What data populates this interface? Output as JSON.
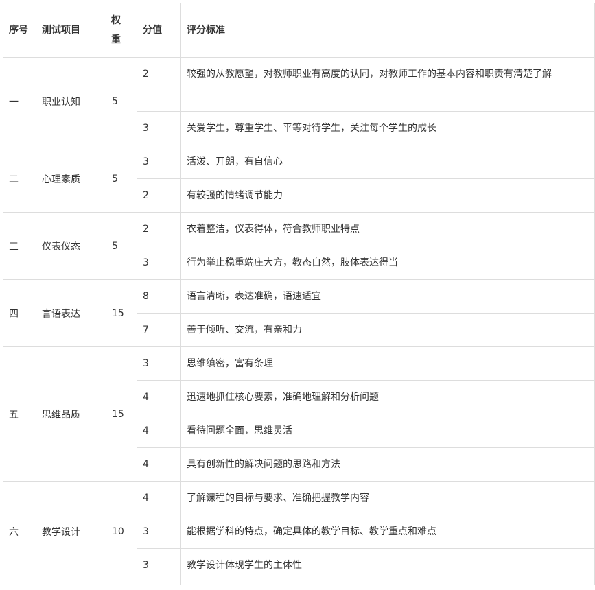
{
  "table": {
    "headers": {
      "seq": "序号",
      "item": "测试项目",
      "weight": "权重",
      "score": "分值",
      "criteria": "评分标准"
    },
    "groups": [
      {
        "seq": "一",
        "item": "职业认知",
        "weight": "5",
        "rows": [
          {
            "score": "2",
            "criteria": "较强的从教愿望，对教师职业有高度的认同，对教师工作的基本内容和职责有清楚了解"
          },
          {
            "score": "3",
            "criteria": "关爱学生，尊重学生、平等对待学生，关注每个学生的成长"
          }
        ]
      },
      {
        "seq": "二",
        "item": "心理素质",
        "weight": "5",
        "rows": [
          {
            "score": "3",
            "criteria": "活泼、开朗，有自信心"
          },
          {
            "score": "2",
            "criteria": "有较强的情绪调节能力"
          }
        ]
      },
      {
        "seq": "三",
        "item": "仪表仪态",
        "weight": "5",
        "rows": [
          {
            "score": "2",
            "criteria": "衣着整洁，仪表得体，符合教师职业特点"
          },
          {
            "score": "3",
            "criteria": "行为举止稳重端庄大方，教态自然，肢体表达得当"
          }
        ]
      },
      {
        "seq": "四",
        "item": "言语表达",
        "weight": "15",
        "rows": [
          {
            "score": "8",
            "criteria": "语言清晰，表达准确，语速适宜"
          },
          {
            "score": "7",
            "criteria": "善于倾听、交流，有亲和力"
          }
        ]
      },
      {
        "seq": "五",
        "item": "思维品质",
        "weight": "15",
        "rows": [
          {
            "score": "3",
            "criteria": "思维缜密，富有条理"
          },
          {
            "score": "4",
            "criteria": "迅速地抓住核心要素，准确地理解和分析问题"
          },
          {
            "score": "4",
            "criteria": "看待问题全面，思维灵活"
          },
          {
            "score": "4",
            "criteria": "具有创新性的解决问题的思路和方法"
          }
        ]
      },
      {
        "seq": "六",
        "item": "教学设计",
        "weight": "10",
        "rows": [
          {
            "score": "4",
            "criteria": "了解课程的目标与要求、准确把握教学内容"
          },
          {
            "score": "3",
            "criteria": "能根据学科的特点，确定具体的教学目标、教学重点和难点"
          },
          {
            "score": "3",
            "criteria": "教学设计体现学生的主体性"
          }
        ]
      }
    ]
  }
}
